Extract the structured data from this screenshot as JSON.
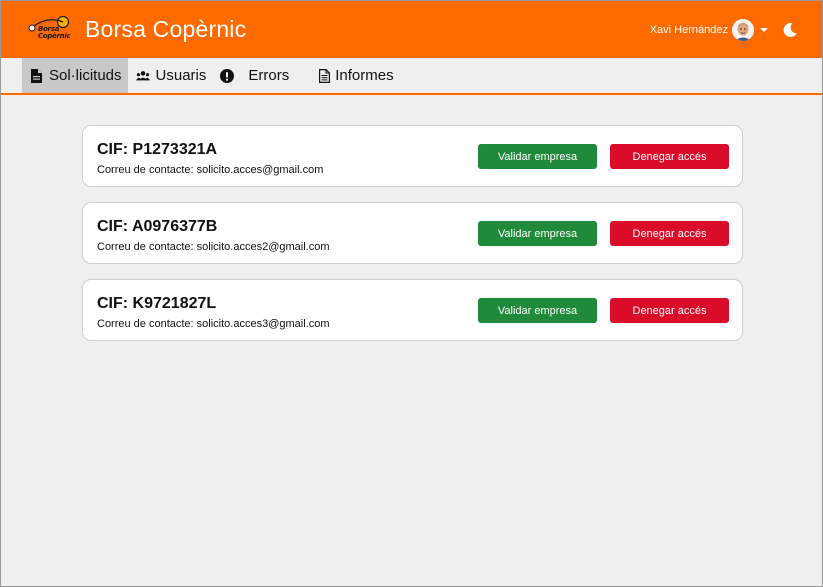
{
  "header": {
    "title": "Borsa Copèrnic",
    "logo_text_line1": "Borsa",
    "logo_text_line2": "Copèrnic",
    "user_name": "Xavi Hernández",
    "theme_icon": "moon-icon",
    "bg_color": "#ff6a00"
  },
  "nav": {
    "items": [
      {
        "label": "Sol·licituds",
        "icon": "document-icon",
        "active": true
      },
      {
        "label": "Usuaris",
        "icon": "users-icon",
        "active": false
      },
      {
        "label": "Errors",
        "icon": "exclamation-circle-icon",
        "active": false
      },
      {
        "label": "Informes",
        "icon": "report-icon",
        "active": false
      }
    ]
  },
  "requests": [
    {
      "cif": "CIF: P1273321A",
      "email": "Correu de contacte: solicito.acces@gmail.com",
      "validate_label": "Validar empresa",
      "deny_label": "Denegar accés"
    },
    {
      "cif": "CIF: A0976377B",
      "email": "Correu de contacte: solicito.acces2@gmail.com",
      "validate_label": "Validar empresa",
      "deny_label": "Denegar accés"
    },
    {
      "cif": "CIF: K9721827L",
      "email": "Correu de contacte: solicito.acces3@gmail.com",
      "validate_label": "Validar empresa",
      "deny_label": "Denegar accés"
    }
  ],
  "colors": {
    "validate": "#1e8a3a",
    "deny": "#db0b2a",
    "accent": "#ff6a00"
  }
}
